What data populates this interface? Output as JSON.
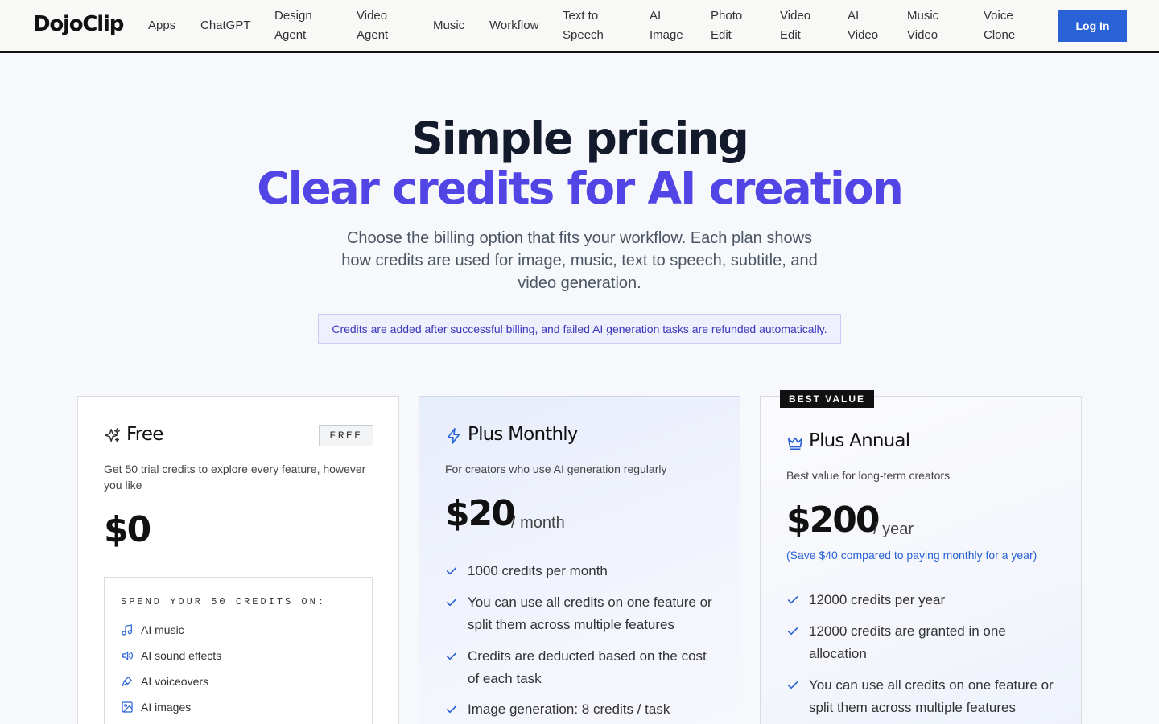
{
  "brand": {
    "logo": "DojoClip"
  },
  "nav": {
    "items": [
      {
        "label": "Apps"
      },
      {
        "label": "ChatGPT"
      },
      {
        "label": "Design Agent"
      },
      {
        "label": "Video Agent"
      },
      {
        "label": "Music"
      },
      {
        "label": "Workflow"
      },
      {
        "label": "Text to Speech"
      },
      {
        "label": "AI Image"
      },
      {
        "label": "Photo Edit"
      },
      {
        "label": "Video Edit"
      },
      {
        "label": "AI Video"
      },
      {
        "label": "Music Video"
      },
      {
        "label": "Voice Clone"
      }
    ],
    "login_label": "Log In"
  },
  "hero": {
    "title": "Simple pricing",
    "subtitle": "Clear credits for AI creation",
    "description": "Choose the billing option that fits your workflow. Each plan shows how credits are used for image, music, text to speech, subtitle, and video generation.",
    "notice": "Credits are added after successful billing, and failed AI generation tasks are refunded automatically."
  },
  "plans": {
    "free": {
      "icon": "sparkle-icon",
      "name": "Free",
      "badge": "FREE",
      "description": "Get 50 trial credits to explore every feature, however you like",
      "price": "$0",
      "spend_title": "SPEND YOUR 50 CREDITS ON:",
      "spend_items": [
        {
          "icon": "music-note-icon",
          "label": "AI music"
        },
        {
          "icon": "speaker-icon",
          "label": "AI sound effects"
        },
        {
          "icon": "microphone-icon",
          "label": "AI voiceovers"
        },
        {
          "icon": "image-icon",
          "label": "AI images"
        }
      ]
    },
    "monthly": {
      "icon": "lightning-icon",
      "name": "Plus Monthly",
      "description": "For creators who use AI generation regularly",
      "price": "$20",
      "period": "/ month",
      "features": [
        "1000 credits per month",
        "You can use all credits on one feature or split them across multiple features",
        "Credits are deducted based on the cost of each task",
        "Image generation: 8 credits / task"
      ]
    },
    "annual": {
      "icon": "crown-icon",
      "badge": "BEST VALUE",
      "name": "Plus Annual",
      "description": "Best value for long-term creators",
      "price": "$200",
      "period": "/ year",
      "save_note": "(Save $40 compared to paying monthly for a year)",
      "features": [
        "12000 credits per year",
        "12000 credits are granted in one allocation",
        "You can use all credits on one feature or split them across multiple features"
      ]
    }
  },
  "colors": {
    "accent": "#5145e5",
    "primary_button": "#2962d6",
    "check": "#2962d6"
  }
}
